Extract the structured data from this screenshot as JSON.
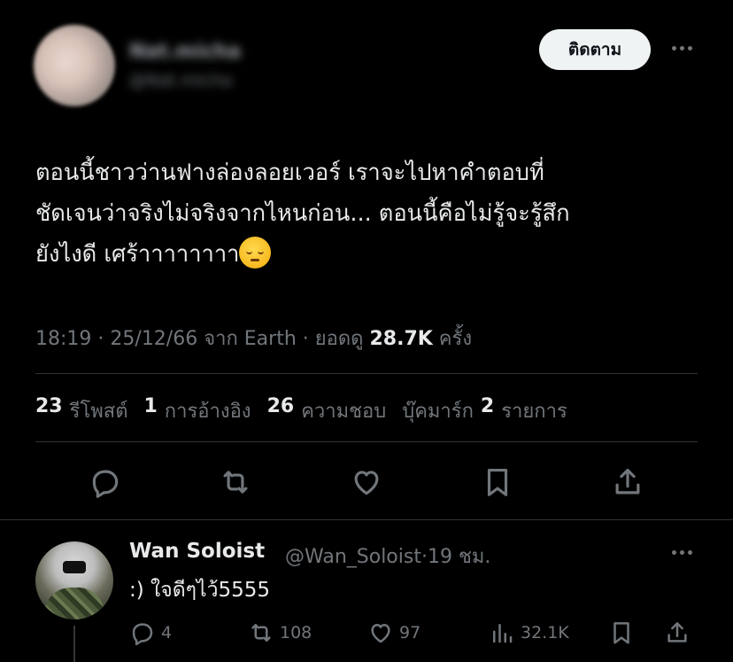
{
  "author": {
    "name": "Nat.micha",
    "handle": "@Nat.micha"
  },
  "follow_button": "ติดตาม",
  "tweet": {
    "text": "ตอนนี้ชาวว่านฟางล่องลอยเวอร์ เราจะไปหาคำตอบที่\nชัดเจนว่าจริงไม่จริงจากไหนก่อน... ตอนนี้คือไม่รู้จะรู้สึก\nยังไงดี เศร้าาาาาาาา",
    "emoji": "pensive-face-emoji",
    "time": "18:19",
    "date": "25/12/66",
    "source": "จาก Earth",
    "views_label": "ยอดดู",
    "views": "28.7K",
    "views_suffix": "ครั้ง"
  },
  "stats": [
    {
      "count": "23",
      "label": "รีโพสต์"
    },
    {
      "count": "1",
      "label": "การอ้างอิง"
    },
    {
      "count": "26",
      "label": "ความชอบ"
    },
    {
      "count": "",
      "label": "บุ๊คมาร์ก"
    },
    {
      "count": "2",
      "label": "รายการ"
    }
  ],
  "actions": [
    "reply-icon",
    "repost-icon",
    "like-icon",
    "bookmark-icon",
    "share-icon"
  ],
  "reply": {
    "name": "Wan Soloist",
    "handle": "@Wan_Soloist",
    "dot": "·",
    "time": "19 ชม.",
    "text": ":) ใจดีๆไว้5555",
    "replies": "4",
    "reposts": "108",
    "likes": "97",
    "views": "32.1K"
  },
  "colors": {
    "background": "#000000",
    "text": "#e7e9ea",
    "muted": "#71767b",
    "divider": "#2f3336",
    "button_bg": "#eff3f4"
  }
}
